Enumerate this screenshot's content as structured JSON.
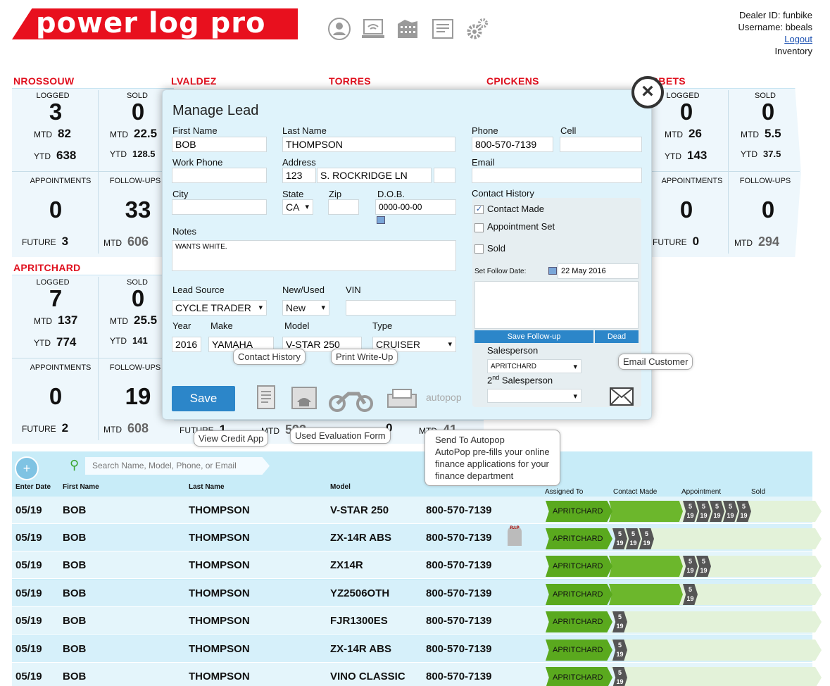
{
  "header": {
    "logo": "power log pro",
    "dealer": "Dealer ID: funbike",
    "username": "Username: bbeals",
    "logout": "Logout",
    "inventory": "Inventory"
  },
  "salespeople": [
    {
      "name": "NROSSOUW",
      "logged": "3",
      "logged_mtd": "82",
      "logged_ytd": "638",
      "sold": "0",
      "sold_mtd": "22.5",
      "sold_ytd": "128.5",
      "appointments": "0",
      "future": "3",
      "followups": "33",
      "fu_mtd": "606"
    },
    {
      "name": "LVALDEZ"
    },
    {
      "name": "TORRES"
    },
    {
      "name": "CPICKENS"
    },
    {
      "name": "BBETS",
      "logged": "0",
      "logged_mtd": "26",
      "logged_ytd": "143",
      "sold": "0",
      "sold_mtd": "5.5",
      "sold_ytd": "37.5",
      "appointments": "0",
      "future": "0",
      "followups": "0",
      "fu_mtd": "294"
    },
    {
      "name": "APRITCHARD",
      "logged": "7",
      "logged_mtd": "137",
      "logged_ytd": "774",
      "sold": "0",
      "sold_mtd": "25.5",
      "sold_ytd": "141",
      "appointments": "0",
      "future": "2",
      "followups": "19",
      "fu_mtd": "608"
    }
  ],
  "stat_labels": {
    "logged": "LOGGED",
    "sold": "SOLD",
    "mtd": "MTD",
    "ytd": "YTD",
    "appointments": "APPOINTMENTS",
    "followups": "FOLLOW-UPS",
    "future": "FUTURE"
  },
  "partial": {
    "future": "FUTURE",
    "future_val": "1",
    "mtd": "MTD",
    "mtd_val": "593",
    "mtd2": "MTD",
    "mtd2_val": "41",
    "zero": "0"
  },
  "search": {
    "placeholder": "Search Name, Model, Phone,  or Email"
  },
  "columns": {
    "enter_date": "Enter Date",
    "first": "First Name",
    "last": "Last Name",
    "model": "Model",
    "assigned": "Assigned To",
    "contact": "Contact Made",
    "appt": "Appointment",
    "sold": "Sold"
  },
  "rows": [
    {
      "date": "05/19",
      "first": "BOB",
      "last": "THOMPSON",
      "model": "V-STAR 250",
      "phone": "800-570-7139",
      "assigned": "APRITCHARD"
    },
    {
      "date": "05/19",
      "first": "BOB",
      "last": "THOMPSON",
      "model": "ZX-14R ABS",
      "phone": "800-570-7139",
      "assigned": "APRITCHARD"
    },
    {
      "date": "05/19",
      "first": "BOB",
      "last": "THOMPSON",
      "model": "ZX14R",
      "phone": "800-570-7139",
      "assigned": "APRITCHARD"
    },
    {
      "date": "05/19",
      "first": "BOB",
      "last": "THOMPSON",
      "model": "YZ2506OTH",
      "phone": "800-570-7139",
      "assigned": "APRITCHARD"
    },
    {
      "date": "05/19",
      "first": "BOB",
      "last": "THOMPSON",
      "model": "FJR1300ES",
      "phone": "800-570-7139",
      "assigned": "APRITCHARD"
    },
    {
      "date": "05/19",
      "first": "BOB",
      "last": "THOMPSON",
      "model": "ZX-14R ABS",
      "phone": "800-570-7139",
      "assigned": "APRITCHARD"
    },
    {
      "date": "05/19",
      "first": "BOB",
      "last": "THOMPSON",
      "model": "VINO CLASSIC",
      "phone": "800-570-7139",
      "assigned": "APRITCHARD"
    }
  ],
  "chevron": {
    "top": "5",
    "bottom": "19"
  },
  "rip": "R.I.P",
  "modal": {
    "title": "Manage Lead",
    "first_name_label": "First Name",
    "first_name": "BOB",
    "last_name_label": "Last Name",
    "last_name": "THOMPSON",
    "phone_label": "Phone",
    "phone": "800-570-7139",
    "cell_label": "Cell",
    "work_phone_label": "Work Phone",
    "address_label": "Address",
    "address_num": "123",
    "address_street": "S. ROCKRIDGE LN",
    "email_label": "Email",
    "city_label": "City",
    "state_label": "State",
    "state": "CA",
    "zip_label": "Zip",
    "dob_label": "D.O.B.",
    "dob": "0000-00-00",
    "notes_label": "Notes",
    "notes": "WANTS WHITE.",
    "contact_history_label": "Contact History",
    "contact_made": "Contact Made",
    "appointment_set": "Appointment Set",
    "sold": "Sold",
    "set_follow_date": "Set Follow Date:",
    "follow_date": "22 May 2016",
    "save_followup": "Save Follow-up",
    "dead": "Dead",
    "salesperson_label": "Salesperson",
    "salesperson": "APRITCHARD",
    "salesperson2_label": "Salesperson",
    "salesperson2_sup": "nd",
    "salesperson2_num": "2",
    "lead_source_label": "Lead Source",
    "lead_source": "CYCLE TRADER",
    "new_used_label": "New/Used",
    "new_used": "New",
    "vin_label": "VIN",
    "year_label": "Year",
    "year": "2016",
    "make_label": "Make",
    "make": "YAMAHA",
    "model_label": "Model",
    "model": "V-STAR 250",
    "type_label": "Type",
    "type": "CRUISER",
    "save": "Save",
    "autopop_logo": "autopop"
  },
  "tooltips": {
    "contact_history": "Contact History",
    "print": "Print Write-Up",
    "email": "Email Customer",
    "credit": "View Credit App",
    "used_eval": "Used Evaluation Form",
    "autopop": "Send To Autopop\nAutoPop pre-fills your online finance applications for your finance department"
  }
}
